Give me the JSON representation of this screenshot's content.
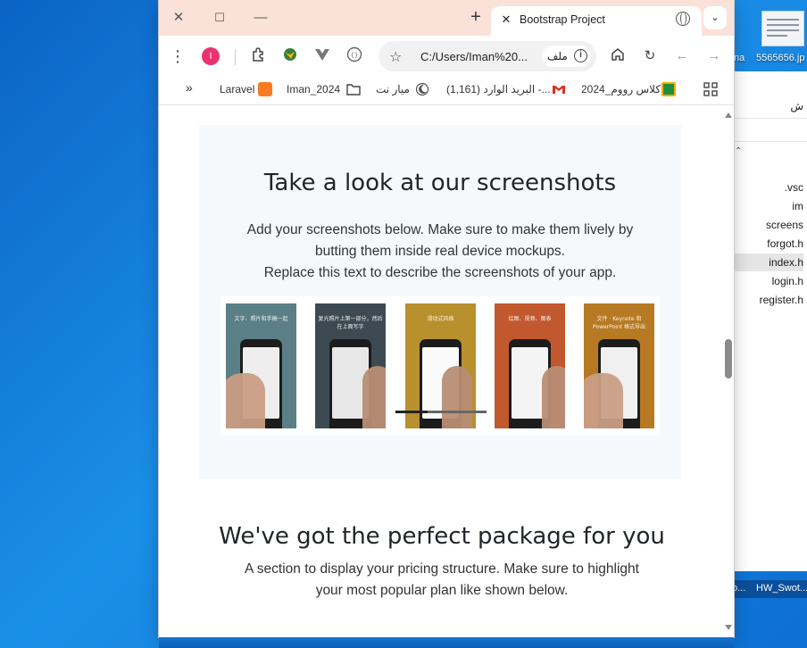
{
  "desktop": {
    "thumbnail_label": "5565656.jp",
    "left_label": "na",
    "taskbar_labels": [
      "o...",
      "HW_Swot..."
    ]
  },
  "explorer": {
    "rtl_label": "ش",
    "files": [
      ".vsc",
      "im",
      "screens",
      "forgot.h",
      "index.h",
      "login.h",
      "register.h"
    ],
    "selected_index": 4
  },
  "browser": {
    "tab_title": "Bootstrap Project",
    "profile_initial": "I",
    "url": "C:/Users/Iman%20...",
    "url_chip": "ملف",
    "bookmarks": [
      {
        "label": "Laravel",
        "icon": "xampp-icon"
      },
      {
        "label": "Iman_2024",
        "icon": "folder-icon"
      },
      {
        "label": "ميار نت",
        "icon": "moon-icon"
      },
      {
        "label": "البريد الوارد (1,161) -...",
        "icon": "gmail-icon"
      },
      {
        "label": "كلاس رووم_2024",
        "icon": "classroom-icon"
      }
    ],
    "bookmarks_overflow": "»"
  },
  "page": {
    "screenshots_title": "Take a look at our screenshots",
    "screenshots_desc_line1": "Add your screenshots below. Make sure to make them lively by",
    "screenshots_desc_line2": "butting them inside real device mockups.",
    "screenshots_desc_line3": "Replace this text to describe the screenshots of your app.",
    "shots": [
      {
        "caption": "文字、照片和手稿一起",
        "bg": "#5b7f86"
      },
      {
        "caption": "复光照片上第一部分，然后在上面写字",
        "bg": "#3e4a52"
      },
      {
        "caption": "滑动式风格",
        "bg": "#b8902e"
      },
      {
        "caption": "绘图、视频、图表",
        "bg": "#c2582e"
      },
      {
        "caption": "文件 · Keynote 和 PowerPoint 格式导出",
        "bg": "#b77a22"
      }
    ],
    "package_title": "We've got the perfect package for you",
    "package_desc_line1": "A section to display your pricing structure. Make sure to highlight",
    "package_desc_line2": "your most popular plan like shown below."
  },
  "colors": {
    "tabstrip": "#fae2d9",
    "section_bg": "#f5f9fc",
    "profile": "#e8336f"
  }
}
